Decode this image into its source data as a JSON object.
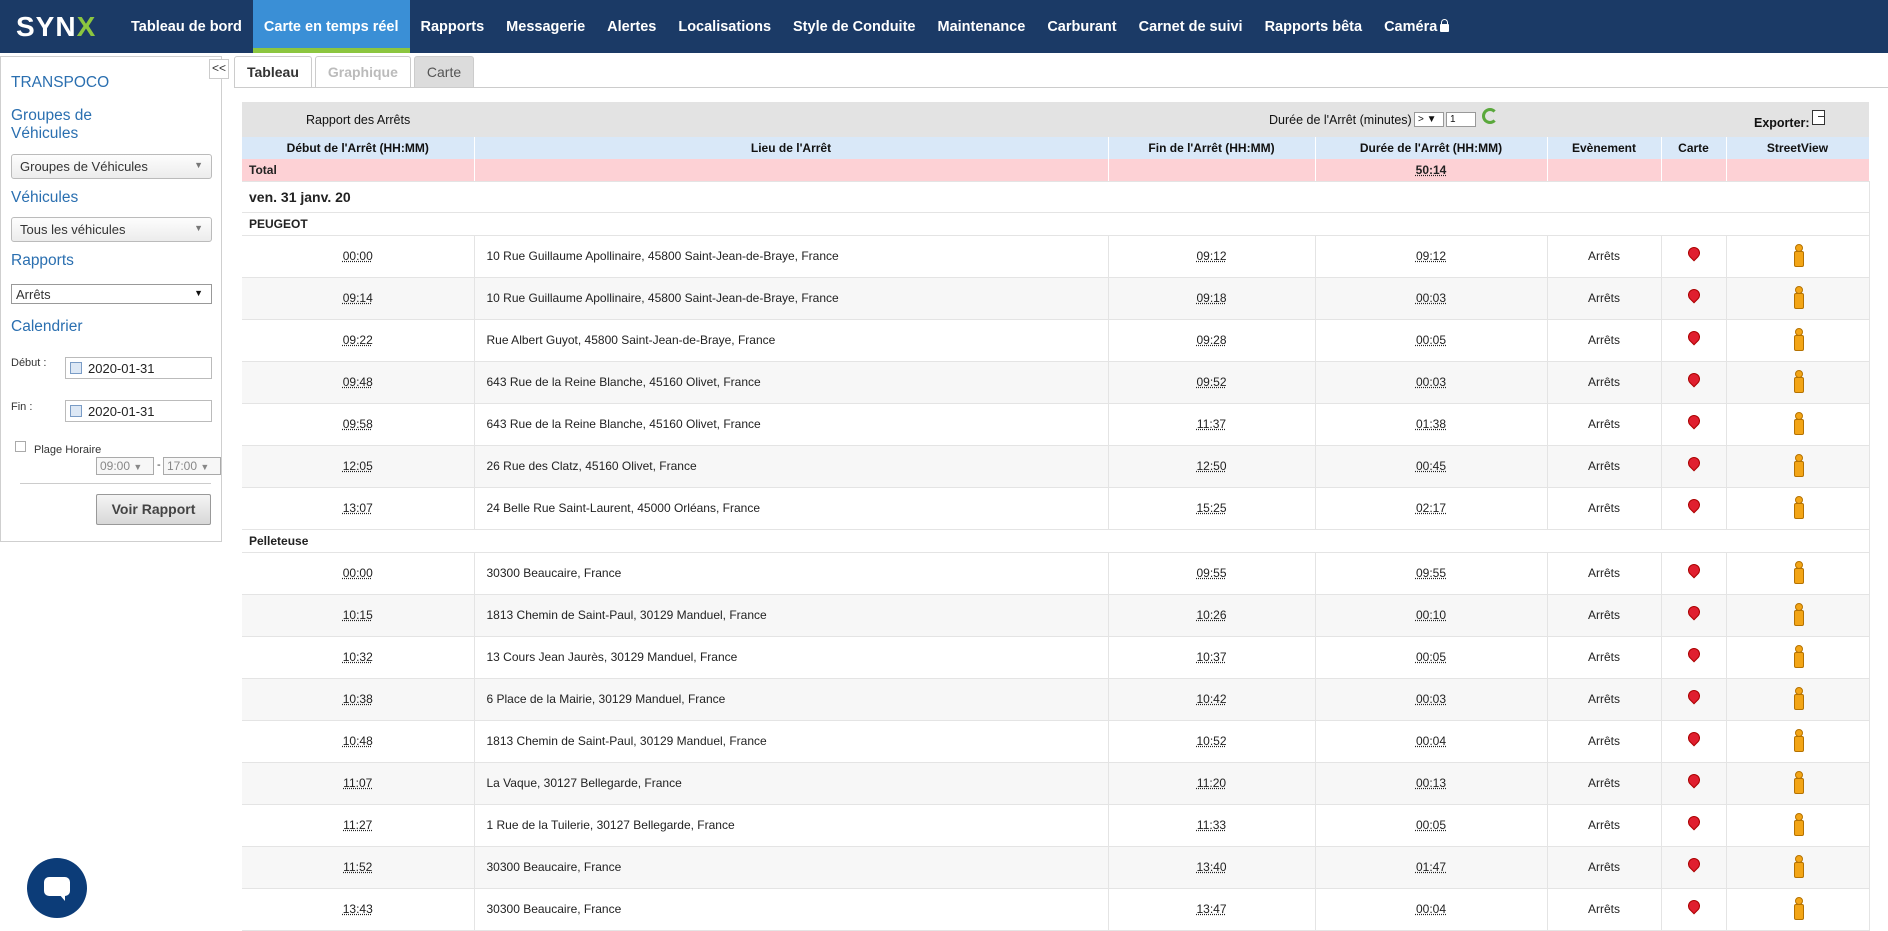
{
  "nav": {
    "logo_main": "SYN",
    "logo_accent": "X",
    "items": [
      {
        "label": "Tableau de bord",
        "active": false
      },
      {
        "label": "Carte en temps réel",
        "active": true
      },
      {
        "label": "Rapports",
        "active": false
      },
      {
        "label": "Messagerie",
        "active": false
      },
      {
        "label": "Alertes",
        "active": false
      },
      {
        "label": "Localisations",
        "active": false
      },
      {
        "label": "Style de Conduite",
        "active": false
      },
      {
        "label": "Maintenance",
        "active": false
      },
      {
        "label": "Carburant",
        "active": false
      },
      {
        "label": "Carnet de suivi",
        "active": false
      },
      {
        "label": "Rapports bêta",
        "active": false
      },
      {
        "label": "Caméra",
        "active": false,
        "icon": "lock-icon"
      }
    ]
  },
  "sidebar": {
    "collapse_label": "<<",
    "company": "TRANSPOCO",
    "groups_title": "Groupes de Véhicules",
    "groups_select": "Groupes de Véhicules",
    "vehicles_title": "Véhicules",
    "vehicles_select": "Tous les véhicules",
    "reports_title": "Rapports",
    "reports_select": "Arrêts",
    "calendar_title": "Calendrier",
    "start_label": "Début :",
    "start_value": "2020-01-31",
    "end_label": "Fin :",
    "end_value": "2020-01-31",
    "time_range_label": "Plage Horaire",
    "time_from": "09:00",
    "time_separator": "-",
    "time_to": "17:00",
    "submit_label": "Voir Rapport"
  },
  "tabs": [
    {
      "label": "Tableau",
      "state": "active"
    },
    {
      "label": "Graphique",
      "state": "disabled"
    },
    {
      "label": "Carte",
      "state": "gray"
    }
  ],
  "report": {
    "title": "Rapport des Arrêts",
    "duration_label": "Durée de l'Arrêt (minutes)",
    "duration_operator": ">",
    "duration_value": "1",
    "export_label": "Exporter:",
    "columns": [
      "Début de l'Arrêt (HH:MM)",
      "Lieu de l'Arrêt",
      "Fin de l'Arrêt (HH:MM)",
      "Durée de l'Arrêt (HH:MM)",
      "Evènement",
      "Carte",
      "StreetView"
    ],
    "total_label": "Total",
    "total_duration": "50:14",
    "date_heading": "ven. 31 janv. 20",
    "groups": [
      {
        "vehicle": "PEUGEOT",
        "rows": [
          {
            "start": "00:00",
            "place": "10 Rue Guillaume Apollinaire, 45800 Saint-Jean-de-Braye, France",
            "end": "09:12",
            "duration": "09:12",
            "event": "Arrêts"
          },
          {
            "start": "09:14",
            "place": "10 Rue Guillaume Apollinaire, 45800 Saint-Jean-de-Braye, France",
            "end": "09:18",
            "duration": "00:03",
            "event": "Arrêts"
          },
          {
            "start": "09:22",
            "place": "Rue Albert Guyot, 45800 Saint-Jean-de-Braye, France",
            "end": "09:28",
            "duration": "00:05",
            "event": "Arrêts"
          },
          {
            "start": "09:48",
            "place": "643 Rue de la Reine Blanche, 45160 Olivet, France",
            "end": "09:52",
            "duration": "00:03",
            "event": "Arrêts"
          },
          {
            "start": "09:58",
            "place": "643 Rue de la Reine Blanche, 45160 Olivet, France",
            "end": "11:37",
            "duration": "01:38",
            "event": "Arrêts"
          },
          {
            "start": "12:05",
            "place": "26 Rue des Clatz, 45160 Olivet, France",
            "end": "12:50",
            "duration": "00:45",
            "event": "Arrêts"
          },
          {
            "start": "13:07",
            "place": "24 Belle Rue Saint-Laurent, 45000 Orléans, France",
            "end": "15:25",
            "duration": "02:17",
            "event": "Arrêts"
          }
        ]
      },
      {
        "vehicle": "Pelleteuse",
        "rows": [
          {
            "start": "00:00",
            "place": "30300 Beaucaire, France",
            "end": "09:55",
            "duration": "09:55",
            "event": "Arrêts"
          },
          {
            "start": "10:15",
            "place": "1813 Chemin de Saint-Paul, 30129 Manduel, France",
            "end": "10:26",
            "duration": "00:10",
            "event": "Arrêts"
          },
          {
            "start": "10:32",
            "place": "13 Cours Jean Jaurès, 30129 Manduel, France",
            "end": "10:37",
            "duration": "00:05",
            "event": "Arrêts"
          },
          {
            "start": "10:38",
            "place": "6 Place de la Mairie, 30129 Manduel, France",
            "end": "10:42",
            "duration": "00:03",
            "event": "Arrêts"
          },
          {
            "start": "10:48",
            "place": "1813 Chemin de Saint-Paul, 30129 Manduel, France",
            "end": "10:52",
            "duration": "00:04",
            "event": "Arrêts"
          },
          {
            "start": "11:07",
            "place": "La Vaque, 30127 Bellegarde, France",
            "end": "11:20",
            "duration": "00:13",
            "event": "Arrêts"
          },
          {
            "start": "11:27",
            "place": "1 Rue de la Tuilerie, 30127 Bellegarde, France",
            "end": "11:33",
            "duration": "00:05",
            "event": "Arrêts"
          },
          {
            "start": "11:52",
            "place": "30300 Beaucaire, France",
            "end": "13:40",
            "duration": "01:47",
            "event": "Arrêts"
          },
          {
            "start": "13:43",
            "place": "30300 Beaucaire, France",
            "end": "13:47",
            "duration": "00:04",
            "event": "Arrêts"
          }
        ]
      }
    ]
  },
  "colors": {
    "nav_bg": "#1b3a66",
    "nav_active": "#3a8fd6",
    "accent_green": "#8cc63f",
    "header_row": "#d9e8f8",
    "total_row": "#fdd1d5",
    "pin": "#e01f2f",
    "pegman": "#f3a516"
  }
}
